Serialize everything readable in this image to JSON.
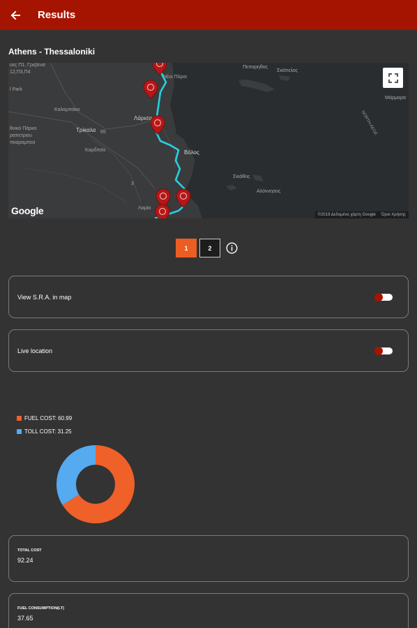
{
  "appbar": {
    "title": "Results",
    "back_icon": "arrow-left-icon"
  },
  "route": {
    "title": "Athens - Thessaloniki"
  },
  "map": {
    "labels": {
      "top_left_1": "ύες Π1, Γρεβενά",
      "top_left_2": "12,Π3,Π4",
      "park": "l Park",
      "kalampaka": "Καλαμπάκα",
      "trikala": "Τρίκαλα",
      "park_left_1": "θνικό Πάρκο",
      "park_left_2": "ραπετριου",
      "park_left_3": "πκαραμπεα",
      "karditsa": "Καρδίτσα",
      "larissa": "Λάρισα",
      "volos": "Βόλος",
      "nea_poroi": "Νέοι Πόροι",
      "skiathos": "Σκιάθος",
      "peparithos": "Πεπαρηθος",
      "skopelos": "Σκόπελος",
      "alonissos": "Αλόννησος",
      "lamia": "Λαμία",
      "north_aegean": "NORTH AEGE",
      "marmara": "Μάρμαρα",
      "label_65": "65",
      "label_3": "3"
    },
    "google_logo": "Google",
    "attribution": "©2019 Δεδομένα χάρτη Google",
    "terms": "Όροι Χρήσης",
    "fullscreen_icon": "fullscreen-icon",
    "pin_count": 5
  },
  "pager": {
    "pages": [
      "1",
      "2"
    ],
    "active_page": "1",
    "info_icon": "info-icon"
  },
  "toggles": [
    {
      "label": "View S.R.A. in map",
      "enabled": true
    },
    {
      "label": "Live location",
      "enabled": true
    }
  ],
  "legend": [
    {
      "label": "FUEL COST: 60.99",
      "color": "#f06029"
    },
    {
      "label": "TOLL COST: 31.25",
      "color": "#55aaf0"
    }
  ],
  "chart_data": {
    "type": "pie",
    "categories": [
      "FUEL COST",
      "TOLL COST"
    ],
    "values": [
      60.99,
      31.25
    ],
    "colors": [
      "#f06029",
      "#55aaf0"
    ]
  },
  "stats": [
    {
      "label": "TOTAL COST",
      "value": "92.24"
    },
    {
      "label": "FUEL CONSUMPTION(lt)",
      "value": "37.65"
    }
  ]
}
